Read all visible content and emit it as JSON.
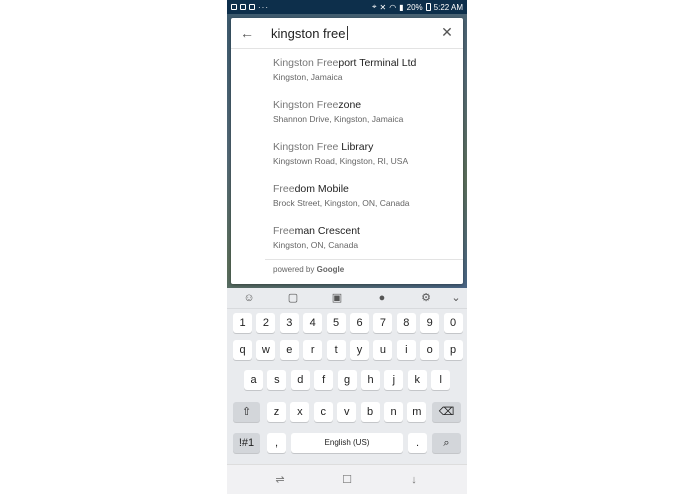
{
  "status_bar": {
    "battery": "20%",
    "time": "5:22 AM",
    "dots": "···"
  },
  "search": {
    "query": "kingston free",
    "back_icon": "arrow-left-icon",
    "clear_icon": "close-icon"
  },
  "results": [
    {
      "match": "Kingston Free",
      "rest": "port Terminal Ltd",
      "subtitle": "Kingston, Jamaica"
    },
    {
      "match": "Kingston Free",
      "rest": "zone",
      "subtitle": "Shannon Drive, Kingston, Jamaica"
    },
    {
      "match": "Kingston Free",
      "rest": " Library",
      "subtitle": "Kingstown Road, Kingston, RI, USA"
    },
    {
      "match": "Free",
      "rest": "dom Mobile",
      "subtitle": "Brock Street, Kingston, ON, Canada"
    },
    {
      "match": "Free",
      "rest": "man Crescent",
      "subtitle": "Kingston, ON, Canada"
    }
  ],
  "powered_by": {
    "prefix": "powered by ",
    "brand": "Google"
  },
  "keyboard": {
    "toolbar_icons": [
      "emoji-icon",
      "sticker-icon",
      "gif-icon",
      "mic-icon",
      "gear-icon",
      "chevron-down-icon"
    ],
    "row1": [
      "1",
      "2",
      "3",
      "4",
      "5",
      "6",
      "7",
      "8",
      "9",
      "0"
    ],
    "row2": [
      "q",
      "w",
      "e",
      "r",
      "t",
      "y",
      "u",
      "i",
      "o",
      "p"
    ],
    "row3": [
      "a",
      "s",
      "d",
      "f",
      "g",
      "h",
      "j",
      "k",
      "l"
    ],
    "row4": [
      "z",
      "x",
      "c",
      "v",
      "b",
      "n",
      "m"
    ],
    "symbols_label": "!#1",
    "comma": ",",
    "space_label": "English (US)",
    "period": ".",
    "shift_glyph": "⇧",
    "backspace_glyph": "⌫",
    "search_glyph": "⌕"
  },
  "navbar": {
    "recent_glyph": "⇌",
    "home_glyph": "☐",
    "back_glyph": "↓"
  }
}
